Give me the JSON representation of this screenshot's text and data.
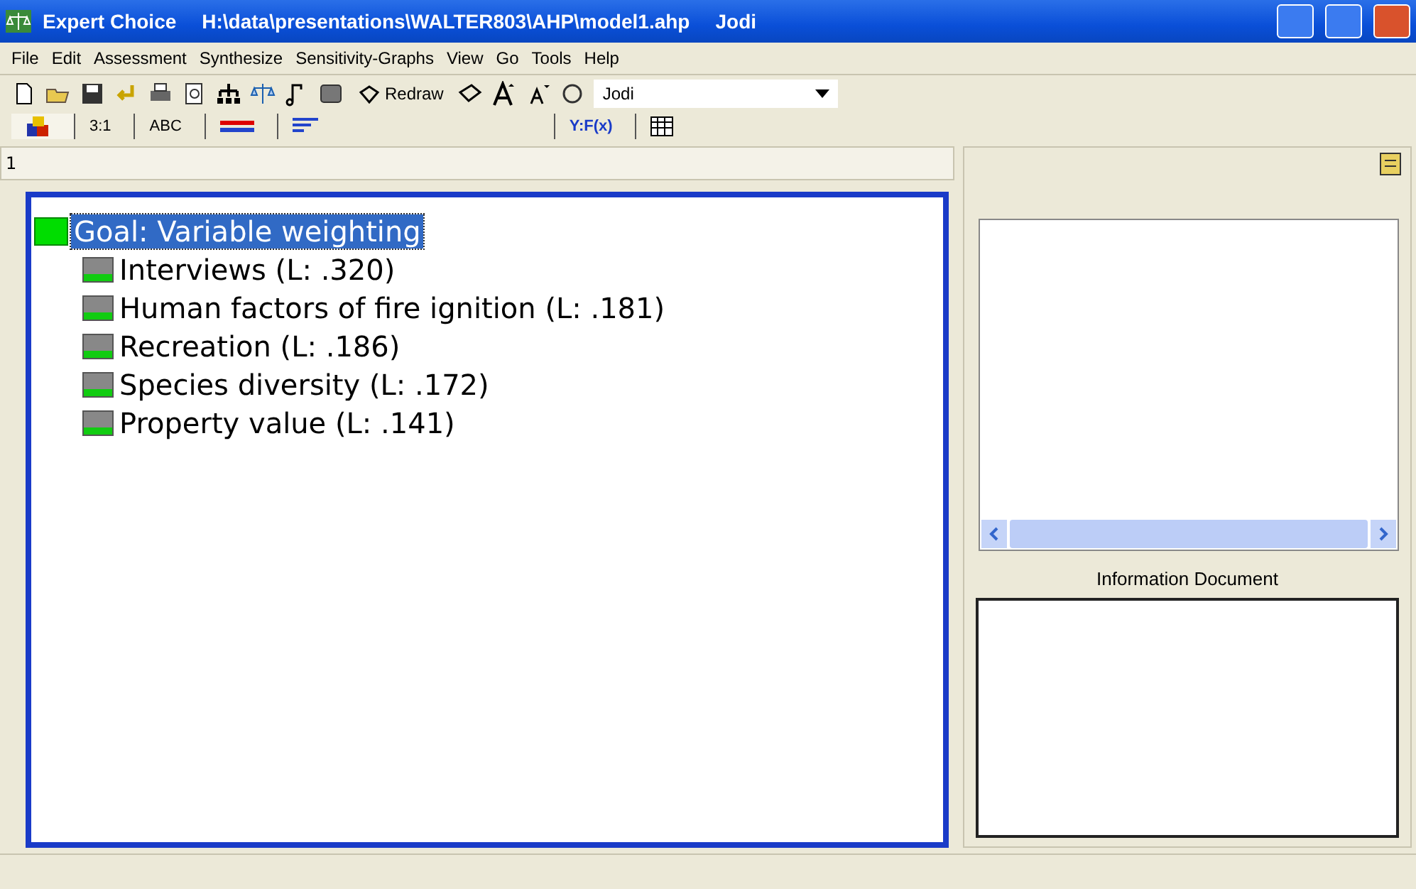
{
  "window": {
    "app": "Expert Choice",
    "path": "H:\\data\\presentations\\WALTER803\\AHP\\model1.ahp",
    "user": "Jodi"
  },
  "menu": [
    "File",
    "Edit",
    "Assessment",
    "Synthesize",
    "Sensitivity-Graphs",
    "View",
    "Go",
    "Tools",
    "Help"
  ],
  "toolbar": {
    "redraw": "Redraw",
    "user_select": "Jodi"
  },
  "view_tabs": [
    {
      "kind": "icon",
      "selected": true
    },
    {
      "kind": "text",
      "label": "3:1",
      "selected": false
    },
    {
      "kind": "text",
      "label": "ABC",
      "selected": false
    },
    {
      "kind": "bars",
      "selected": false
    },
    {
      "kind": "sort",
      "selected": false
    },
    {
      "kind": "formula",
      "label": "Y:F(x)",
      "selected": false
    },
    {
      "kind": "grid",
      "selected": false
    }
  ],
  "header": "1",
  "tree": {
    "label": "Goal:  Variable weighting",
    "selected": true,
    "children": [
      {
        "label": "Interviews (L: .320)",
        "selected": false
      },
      {
        "label": "Human factors of fire ignition (L: .181)",
        "selected": false
      },
      {
        "label": "Recreation (L: .186)",
        "selected": false
      },
      {
        "label": "Species diversity (L: .172)",
        "selected": false
      },
      {
        "label": "Property value (L: .141)",
        "selected": false
      }
    ]
  },
  "info_label": "Information Document"
}
